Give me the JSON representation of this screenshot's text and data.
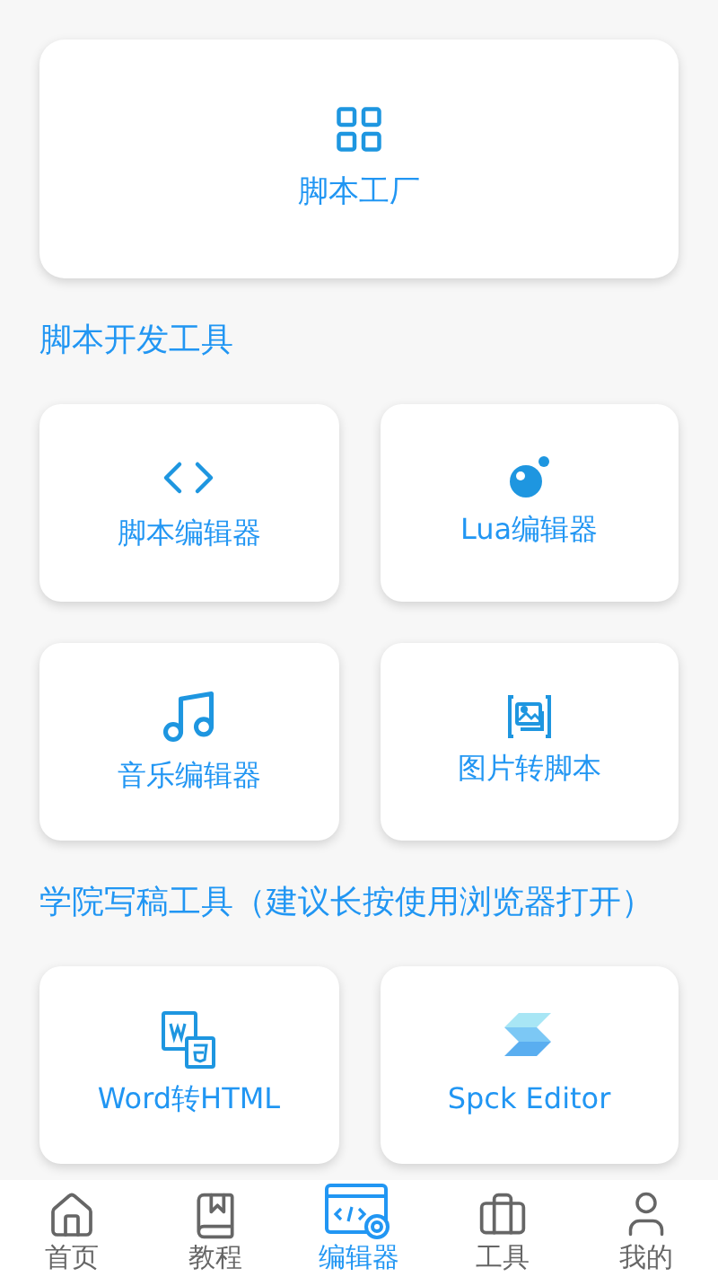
{
  "top_card": {
    "label": "脚本工厂"
  },
  "sections": [
    {
      "title": "脚本开发工具",
      "cards": [
        {
          "label": "脚本编辑器"
        },
        {
          "label": "Lua编辑器"
        },
        {
          "label": "音乐编辑器"
        },
        {
          "label": "图片转脚本"
        }
      ]
    },
    {
      "title": "学院写稿工具（建议长按使用浏览器打开）",
      "cards": [
        {
          "label": "Word转HTML"
        },
        {
          "label": "Spck Editor"
        }
      ]
    }
  ],
  "bottom_nav": [
    {
      "label": "首页",
      "selected": false
    },
    {
      "label": "教程",
      "selected": false
    },
    {
      "label": "编辑器",
      "selected": true
    },
    {
      "label": "工具",
      "selected": false
    },
    {
      "label": "我的",
      "selected": false
    }
  ]
}
